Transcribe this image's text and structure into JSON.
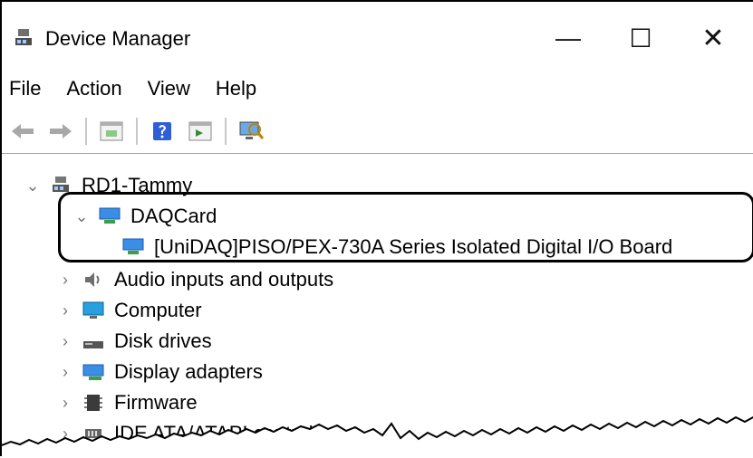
{
  "window": {
    "title": "Device Manager",
    "buttons": {
      "minimize": "—",
      "maximize": "☐",
      "close": "✕"
    }
  },
  "menu": [
    "File",
    "Action",
    "View",
    "Help"
  ],
  "toolbar": [
    "back",
    "forward",
    "properties",
    "help",
    "update-driver",
    "scan-hardware"
  ],
  "tree": {
    "root": "RD1-Tammy",
    "groups": [
      {
        "label": "DAQCard",
        "expanded": true,
        "children": [
          "[UniDAQ]PISO/PEX-730A Series Isolated Digital I/O Board"
        ]
      },
      {
        "label": "Audio inputs and outputs"
      },
      {
        "label": "Computer"
      },
      {
        "label": "Disk drives"
      },
      {
        "label": "Display adapters"
      },
      {
        "label": "Firmware"
      },
      {
        "label": "IDE ATA/ATAPI controllers"
      }
    ]
  },
  "colors": {
    "frame": "#000000",
    "separator": "#a0a0a0",
    "accent": "#1e90ff"
  }
}
